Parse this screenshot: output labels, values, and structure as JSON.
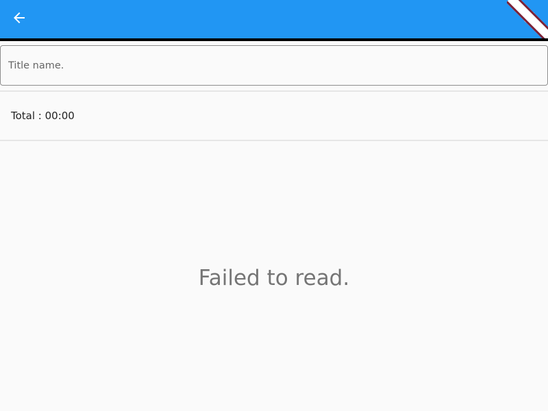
{
  "appbar": {
    "background_color": "#2196f3",
    "back_icon": "arrow-back-icon",
    "action_icon": "refresh-icon"
  },
  "title_field": {
    "value": "",
    "placeholder": "Title name."
  },
  "summary": {
    "total_text": "Total : 00:00"
  },
  "status": {
    "message": "Failed to read."
  },
  "debug_banner": {
    "colors": [
      "#7b2238",
      "#ffffff"
    ]
  }
}
